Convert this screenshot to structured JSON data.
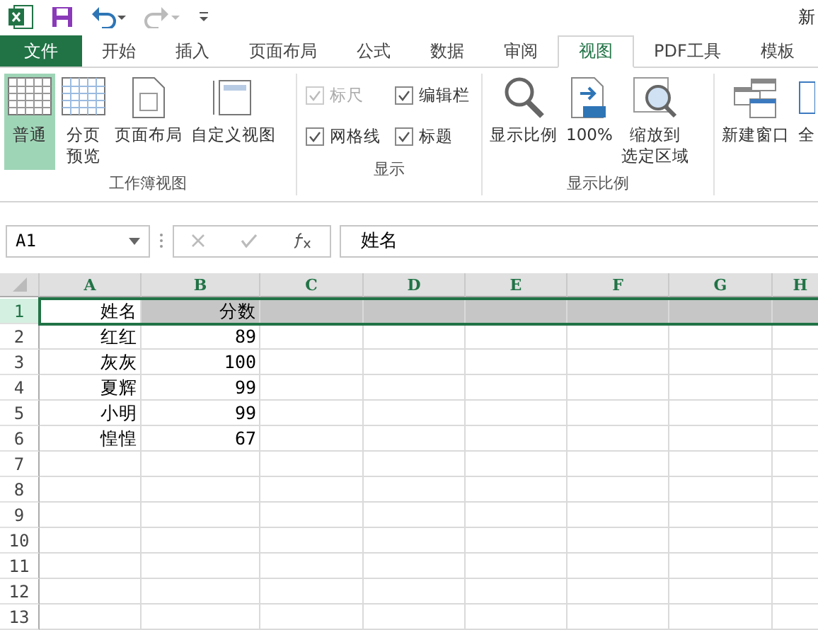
{
  "window": {
    "title": "新"
  },
  "tabs": [
    {
      "label": "文件",
      "kind": "file",
      "selected": false
    },
    {
      "label": "开始",
      "kind": "tab",
      "selected": false
    },
    {
      "label": "插入",
      "kind": "tab",
      "selected": false
    },
    {
      "label": "页面布局",
      "kind": "tab",
      "selected": false
    },
    {
      "label": "公式",
      "kind": "tab",
      "selected": false
    },
    {
      "label": "数据",
      "kind": "tab",
      "selected": false
    },
    {
      "label": "审阅",
      "kind": "tab",
      "selected": false
    },
    {
      "label": "视图",
      "kind": "tab",
      "selected": true
    },
    {
      "label": "PDF工具",
      "kind": "tab",
      "selected": false
    },
    {
      "label": "模板",
      "kind": "tab",
      "selected": false
    }
  ],
  "ribbon": {
    "groups": [
      {
        "label": "工作簿视图",
        "kind": "buttons",
        "items": [
          {
            "lines": [
              "普通"
            ],
            "selected": true
          },
          {
            "lines": [
              "分页",
              "预览"
            ],
            "selected": false
          },
          {
            "lines": [
              "页面布局"
            ],
            "selected": false
          },
          {
            "lines": [
              "自定义视图"
            ],
            "selected": false
          }
        ]
      },
      {
        "label": "显示",
        "kind": "checks",
        "items": [
          {
            "label": "标尺",
            "checked": true,
            "disabled": true
          },
          {
            "label": "编辑栏",
            "checked": true,
            "disabled": false
          },
          {
            "label": "网格线",
            "checked": true,
            "disabled": false
          },
          {
            "label": "标题",
            "checked": true,
            "disabled": false
          }
        ]
      },
      {
        "label": "显示比例",
        "kind": "buttons",
        "items": [
          {
            "lines": [
              "显示比例"
            ],
            "selected": false
          },
          {
            "lines": [
              "100%"
            ],
            "selected": false
          },
          {
            "lines": [
              "缩放到",
              "选定区域"
            ],
            "selected": false
          }
        ]
      },
      {
        "kind": "buttons",
        "items": [
          {
            "lines": [
              "新建窗口"
            ],
            "selected": false
          },
          {
            "lines": [
              "全"
            ],
            "selected": false
          }
        ]
      }
    ]
  },
  "formula_bar": {
    "name_box": "A1",
    "value": "姓名"
  },
  "sheet": {
    "columns": [
      "A",
      "B",
      "C",
      "D",
      "E",
      "F",
      "G",
      "H"
    ],
    "rows": [
      {
        "number": "1",
        "cells": [
          "姓名",
          "分数"
        ],
        "selected": true
      },
      {
        "number": "2",
        "cells": [
          "红红",
          "89"
        ],
        "selected": false
      },
      {
        "number": "3",
        "cells": [
          "灰灰",
          "100"
        ],
        "selected": false
      },
      {
        "number": "4",
        "cells": [
          "夏辉",
          "99"
        ],
        "selected": false
      },
      {
        "number": "5",
        "cells": [
          "小明",
          "99"
        ],
        "selected": false
      },
      {
        "number": "6",
        "cells": [
          "惶惶",
          "67"
        ],
        "selected": false
      },
      {
        "number": "7",
        "cells": [],
        "selected": false
      },
      {
        "number": "8",
        "cells": [],
        "selected": false
      },
      {
        "number": "9",
        "cells": [],
        "selected": false
      },
      {
        "number": "10",
        "cells": [],
        "selected": false
      },
      {
        "number": "11",
        "cells": [],
        "selected": false
      },
      {
        "number": "12",
        "cells": [],
        "selected": false
      },
      {
        "number": "13",
        "cells": [],
        "selected": false
      }
    ]
  }
}
